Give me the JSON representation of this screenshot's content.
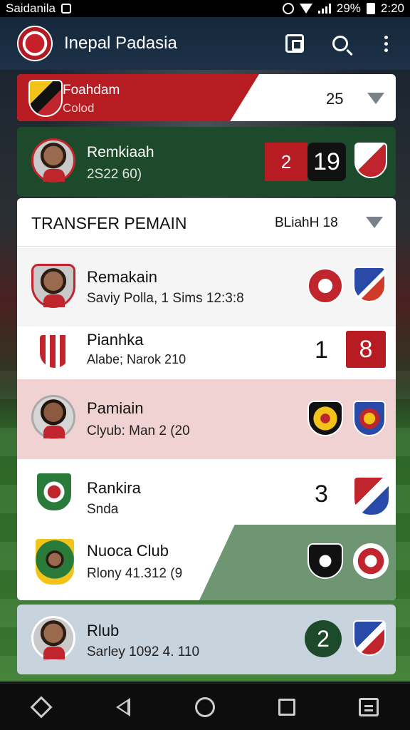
{
  "status_bar": {
    "carrier": "Saidanila",
    "battery": "29%",
    "time": "2:20"
  },
  "app_bar": {
    "title": "Inepal Padasia"
  },
  "top_card": {
    "title": "Foahdam",
    "subtitle": "Colod",
    "score": "25"
  },
  "featured_card": {
    "name": "Remkiaah",
    "subtitle": "2S22 60)",
    "score_left": "2",
    "score_right": "19"
  },
  "transfer_section": {
    "title": "TRANSFER PEMAIN",
    "meta": "BLiahH 18",
    "rows": [
      {
        "name": "Remakain",
        "subtitle": "Saviy Polla, 1 Sims 12:3:8"
      },
      {
        "name": "Pianhka",
        "subtitle": "Alabe; Narok 210",
        "number": "1",
        "box_number": "8"
      },
      {
        "name": "Pamiain",
        "subtitle": "Clyub: Man 2 (20"
      },
      {
        "name": "Rankira",
        "subtitle": "Snda",
        "number": "3"
      },
      {
        "name": "Nuoca Club",
        "subtitle": "Rlony 41.312 (9"
      }
    ]
  },
  "bottom_card": {
    "name": "Rlub",
    "subtitle": "Sarley 1092 4. 110",
    "number": "2"
  },
  "colors": {
    "accent_red": "#b71c22",
    "app_bar": "#16283b",
    "dark_green": "#1d4a2a",
    "pink_row": "#f1d2d2"
  }
}
